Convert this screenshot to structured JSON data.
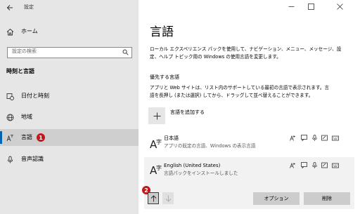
{
  "window": {
    "title": "設定"
  },
  "sidebar": {
    "home": "ホーム",
    "search_placeholder": "設定の検索",
    "section_title": "時刻と言語",
    "items": [
      {
        "label": "日付と時刻"
      },
      {
        "label": "地域"
      },
      {
        "label": "言語",
        "badge": "1"
      },
      {
        "label": "音声認識"
      }
    ]
  },
  "main": {
    "title": "言語",
    "description_line1": "ローカル エクスペリエンス パックを使用して、ナビゲーション、メニュー、メッセージ、設",
    "description_line2": "定、ヘルプ トピック用の Windows の使用言語を変更します。",
    "preferred_heading": "優先する言語",
    "preferred_desc_line1": "アプリと Web サイトは、リスト内のサポートしている最初の言語で表示されます。言",
    "preferred_desc_line2": "語を長押し (または選択) してから、ドラッグして並べ替えることができます。",
    "add_language": "言語を追加する",
    "languages": [
      {
        "name": "日本語",
        "desc": "アプリの既定の言語、Windows の表示言語"
      },
      {
        "name": "English (United States)",
        "desc": "言語パックをインストールしました"
      }
    ],
    "badge2": "2",
    "options_button": "オプション",
    "remove_button": "削除"
  }
}
